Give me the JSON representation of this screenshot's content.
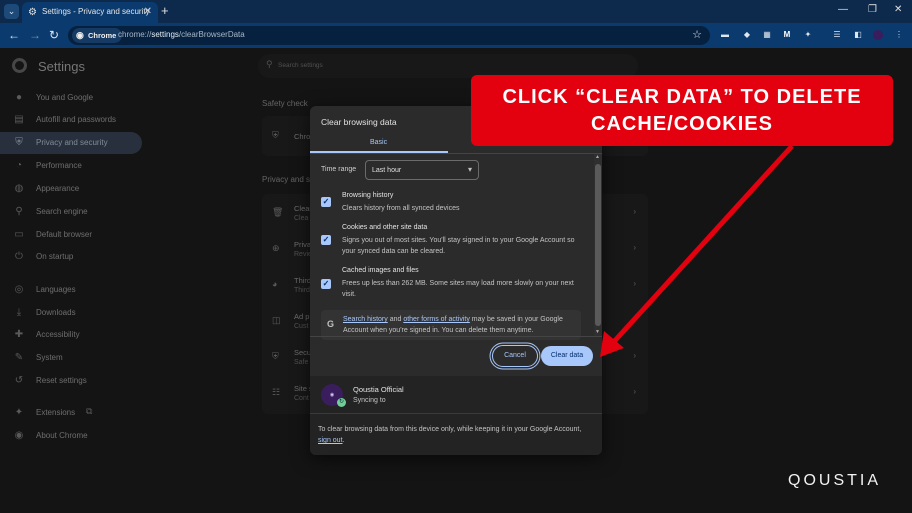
{
  "browser": {
    "tab_title": "Settings - Privacy and security",
    "tab_close": "✕",
    "new_tab": "+",
    "chip_label": "Chrome",
    "url_prefix": "chrome://",
    "url_bold": "settings",
    "url_suffix": "/clearBrowserData",
    "controls": [
      "—",
      "❐",
      "✕"
    ]
  },
  "sidebar": {
    "title": "Settings",
    "items": [
      {
        "label": "You and Google",
        "icon": "person-icon",
        "glyph": "👤"
      },
      {
        "label": "Autofill and passwords",
        "icon": "clipboard-icon",
        "glyph": "▤"
      },
      {
        "label": "Privacy and security",
        "icon": "shield-icon",
        "glyph": "⛨"
      },
      {
        "label": "Performance",
        "icon": "speedometer-icon",
        "glyph": "◔"
      },
      {
        "label": "Appearance",
        "icon": "palette-icon",
        "glyph": "🎨"
      },
      {
        "label": "Search engine",
        "icon": "search-icon",
        "glyph": "🔍"
      },
      {
        "label": "Default browser",
        "icon": "browser-icon",
        "glyph": "▭"
      },
      {
        "label": "On startup",
        "icon": "power-icon",
        "glyph": "⏻"
      },
      {
        "label": "Languages",
        "icon": "globe-icon",
        "glyph": "🌐"
      },
      {
        "label": "Downloads",
        "icon": "download-icon",
        "glyph": "⤓"
      },
      {
        "label": "Accessibility",
        "icon": "accessibility-icon",
        "glyph": "♿"
      },
      {
        "label": "System",
        "icon": "wrench-icon",
        "glyph": "🔧"
      },
      {
        "label": "Reset settings",
        "icon": "reset-icon",
        "glyph": "↺"
      },
      {
        "label": "Extensions",
        "icon": "puzzle-icon",
        "glyph": "✦"
      },
      {
        "label": "About Chrome",
        "icon": "chrome-icon",
        "glyph": "◉"
      }
    ]
  },
  "main": {
    "search_placeholder": "Search settings",
    "safety_check": "Safety check",
    "safety_row": "Chro",
    "privacy_head": "Privacy and s",
    "rows": [
      {
        "t1": "Clear",
        "t2": "Clea"
      },
      {
        "t1": "Priva",
        "t2": "Revie"
      },
      {
        "t1": "Third",
        "t2": "Third"
      },
      {
        "t1": "Ad p",
        "t2": "Cust"
      },
      {
        "t1": "Secu",
        "t2": "Safe"
      },
      {
        "t1": "Site s",
        "t2": "Cont"
      }
    ]
  },
  "dialog": {
    "title": "Clear browsing data",
    "tab_basic": "Basic",
    "time_range_label": "Time range",
    "time_range_value": "Last hour",
    "options": [
      {
        "title": "Browsing history",
        "desc": "Clears history from all synced devices",
        "checked": true
      },
      {
        "title": "Cookies and other site data",
        "desc": "Signs you out of most sites. You'll stay signed in to your Google Account so your synced data can be cleared.",
        "checked": true
      },
      {
        "title": "Cached images and files",
        "desc": "Frees up less than 262 MB. Some sites may load more slowly on your next visit.",
        "checked": true
      }
    ],
    "google_link1": "Search history",
    "google_and": " and ",
    "google_link2": "other forms of activity",
    "google_rest": " may be saved in your Google Account when you're signed in. You can delete them anytime.",
    "cancel": "Cancel",
    "clear": "Clear data",
    "account_name": "Qoustia Official",
    "account_status": "Syncing to",
    "footer_text": "To clear browsing data from this device only, while keeping it in your Google Account, ",
    "footer_link": "sign out",
    "footer_end": "."
  },
  "annotation": {
    "text": "CLICK “CLEAR DATA” TO DELETE CACHE/COOKIES",
    "color": "#e3000f"
  },
  "brand": "QOUSTIA"
}
